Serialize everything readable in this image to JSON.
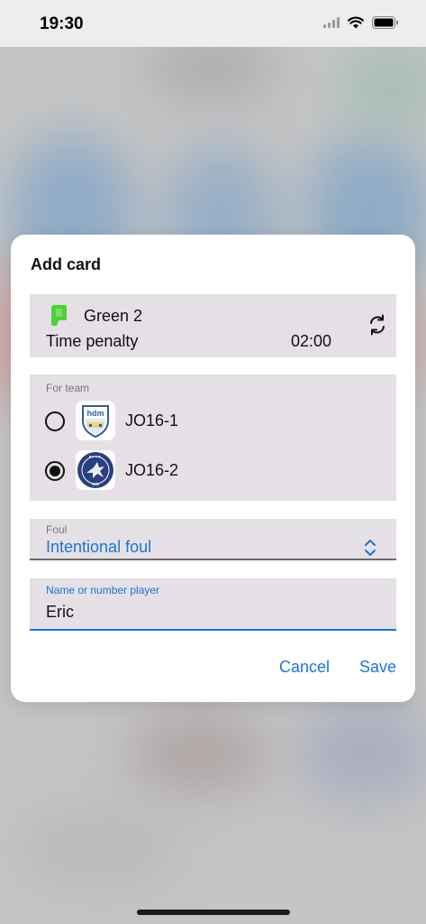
{
  "status_bar": {
    "time": "19:30",
    "icons": [
      "cellular-signal-icon",
      "wifi-icon",
      "battery-icon"
    ]
  },
  "dialog": {
    "title": "Add card",
    "card": {
      "name": "Green 2",
      "type": "Time penalty",
      "duration": "02:00",
      "color": "#4cd137",
      "icons": [
        "card-icon",
        "refresh-icon"
      ]
    },
    "team": {
      "header": "For team",
      "options": [
        {
          "name": "JO16-1",
          "selected": false,
          "logo": "hdm-logo"
        },
        {
          "name": "JO16-2",
          "selected": true,
          "logo": "pinoke-logo"
        }
      ]
    },
    "foul": {
      "label": "Foul",
      "value": "Intentional foul",
      "icon": "chevron-updown-icon"
    },
    "player": {
      "label": "Name or number player",
      "value": "Eric"
    },
    "buttons": {
      "cancel": "Cancel",
      "save": "Save"
    }
  },
  "colors": {
    "accent": "#1976d2",
    "panel": "#e4e0e5",
    "card_green": "#4cd137"
  }
}
